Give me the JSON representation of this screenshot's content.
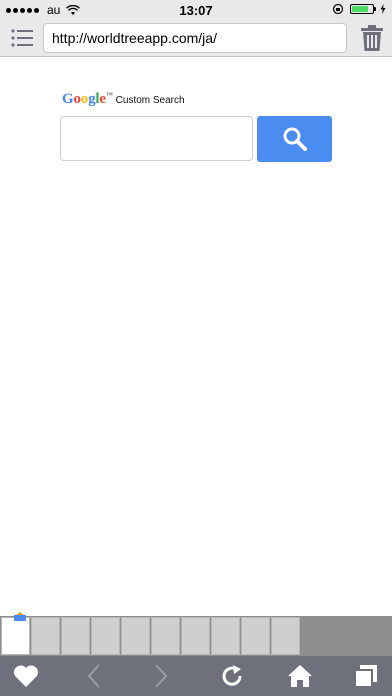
{
  "status_bar": {
    "carrier": "au",
    "time": "13:07",
    "battery_level": 0.8,
    "signal_dots": 5
  },
  "toolbar": {
    "url": "http://worldtreeapp.com/ja/",
    "menu_icon": "list-icon",
    "trash_icon": "trash-icon"
  },
  "search_widget": {
    "brand": "Google",
    "brand_tm": "™",
    "label": "Custom Search",
    "input_value": "",
    "button_icon": "search-icon"
  },
  "tabs": {
    "count": 10,
    "active_index": 0
  },
  "bottom_bar": {
    "items": [
      "heart-icon",
      "back-arrow-icon",
      "forward-arrow-icon",
      "reload-icon",
      "home-icon",
      "tabs-icon"
    ]
  },
  "colors": {
    "google_blue": "#4285f4",
    "google_red": "#ea4335",
    "google_yellow": "#fbbc05",
    "google_green": "#34a853",
    "search_button": "#4a8cf0",
    "bottom_bar": "#6e717c",
    "battery": "#4cd964"
  }
}
